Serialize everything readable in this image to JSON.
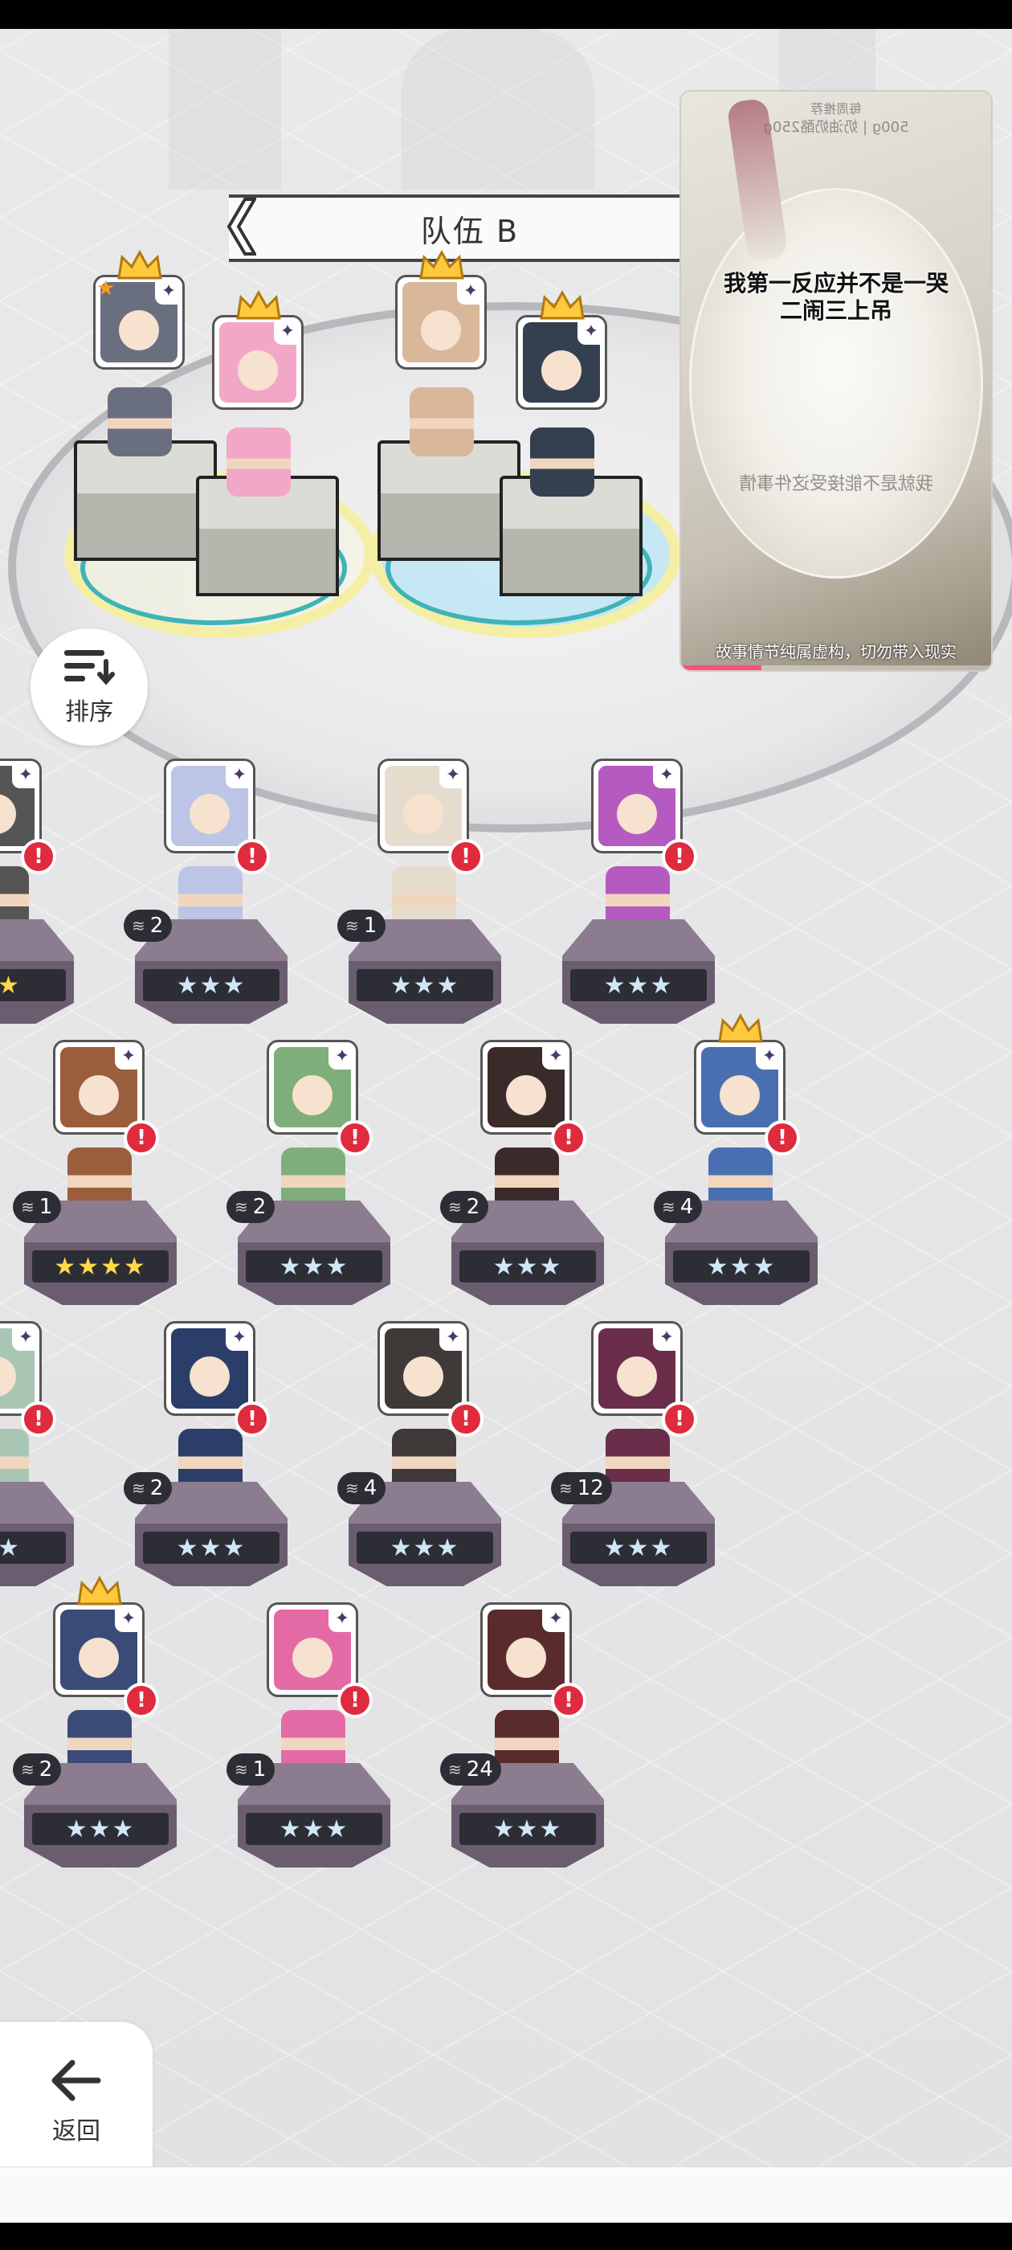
{
  "team": {
    "title": "队伍 B"
  },
  "sort_button": {
    "label": "排序"
  },
  "back_button": {
    "label": "返回"
  },
  "video_overlay": {
    "top_small_1": "每周推荐",
    "top_small_2": "500g | 奶油奶酪250g",
    "caption_line1": "我第一反应并不是一哭",
    "caption_line2": "二闹三上吊",
    "mid_text": "我就是不能接受这件事情",
    "disclaimer": "故事情节纯属虚构，切勿带入现实",
    "progress": 0.26
  },
  "team_slots": [
    {
      "name": "slot-1",
      "crown": true,
      "star_badge": true,
      "color": "#6a6f80"
    },
    {
      "name": "slot-2",
      "crown": true,
      "star_badge": false,
      "color": "#f2a7c6"
    },
    {
      "name": "slot-3",
      "crown": true,
      "star_badge": false,
      "color": "#d9b79b"
    },
    {
      "name": "slot-4",
      "crown": true,
      "star_badge": false,
      "color": "#34404f"
    }
  ],
  "heroes": [
    {
      "count": "",
      "stars": "★★",
      "gold": true,
      "crown": false,
      "color": "#555"
    },
    {
      "count": "2",
      "stars": "★★★",
      "gold": false,
      "crown": false,
      "color": "#bcc5e6"
    },
    {
      "count": "1",
      "stars": "★★★",
      "gold": false,
      "crown": false,
      "color": "#e6dccd"
    },
    {
      "count": "",
      "stars": "★★★",
      "gold": false,
      "crown": false,
      "color": "#b45ac0"
    },
    {
      "count": "1",
      "stars": "★★★★",
      "gold": true,
      "crown": false,
      "color": "#9b5e3c"
    },
    {
      "count": "2",
      "stars": "★★★",
      "gold": false,
      "crown": false,
      "color": "#7fae7a"
    },
    {
      "count": "2",
      "stars": "★★★",
      "gold": false,
      "crown": false,
      "color": "#3a2b2a"
    },
    {
      "count": "4",
      "stars": "★★★",
      "gold": false,
      "crown": true,
      "color": "#4a6fb0"
    },
    {
      "count": "",
      "stars": "★★",
      "gold": false,
      "crown": false,
      "color": "#a9c6b5"
    },
    {
      "count": "2",
      "stars": "★★★",
      "gold": false,
      "crown": false,
      "color": "#2b3e6a"
    },
    {
      "count": "4",
      "stars": "★★★",
      "gold": false,
      "crown": false,
      "color": "#3f3a38"
    },
    {
      "count": "12",
      "stars": "★★★",
      "gold": false,
      "crown": false,
      "color": "#6a2d4a"
    },
    {
      "count": "2",
      "stars": "★★★",
      "gold": false,
      "crown": true,
      "color": "#3a4b78"
    },
    {
      "count": "1",
      "stars": "★★★",
      "gold": false,
      "crown": false,
      "color": "#e46aa6"
    },
    {
      "count": "24",
      "stars": "★★★",
      "gold": false,
      "crown": false,
      "color": "#5a2b2b"
    }
  ]
}
